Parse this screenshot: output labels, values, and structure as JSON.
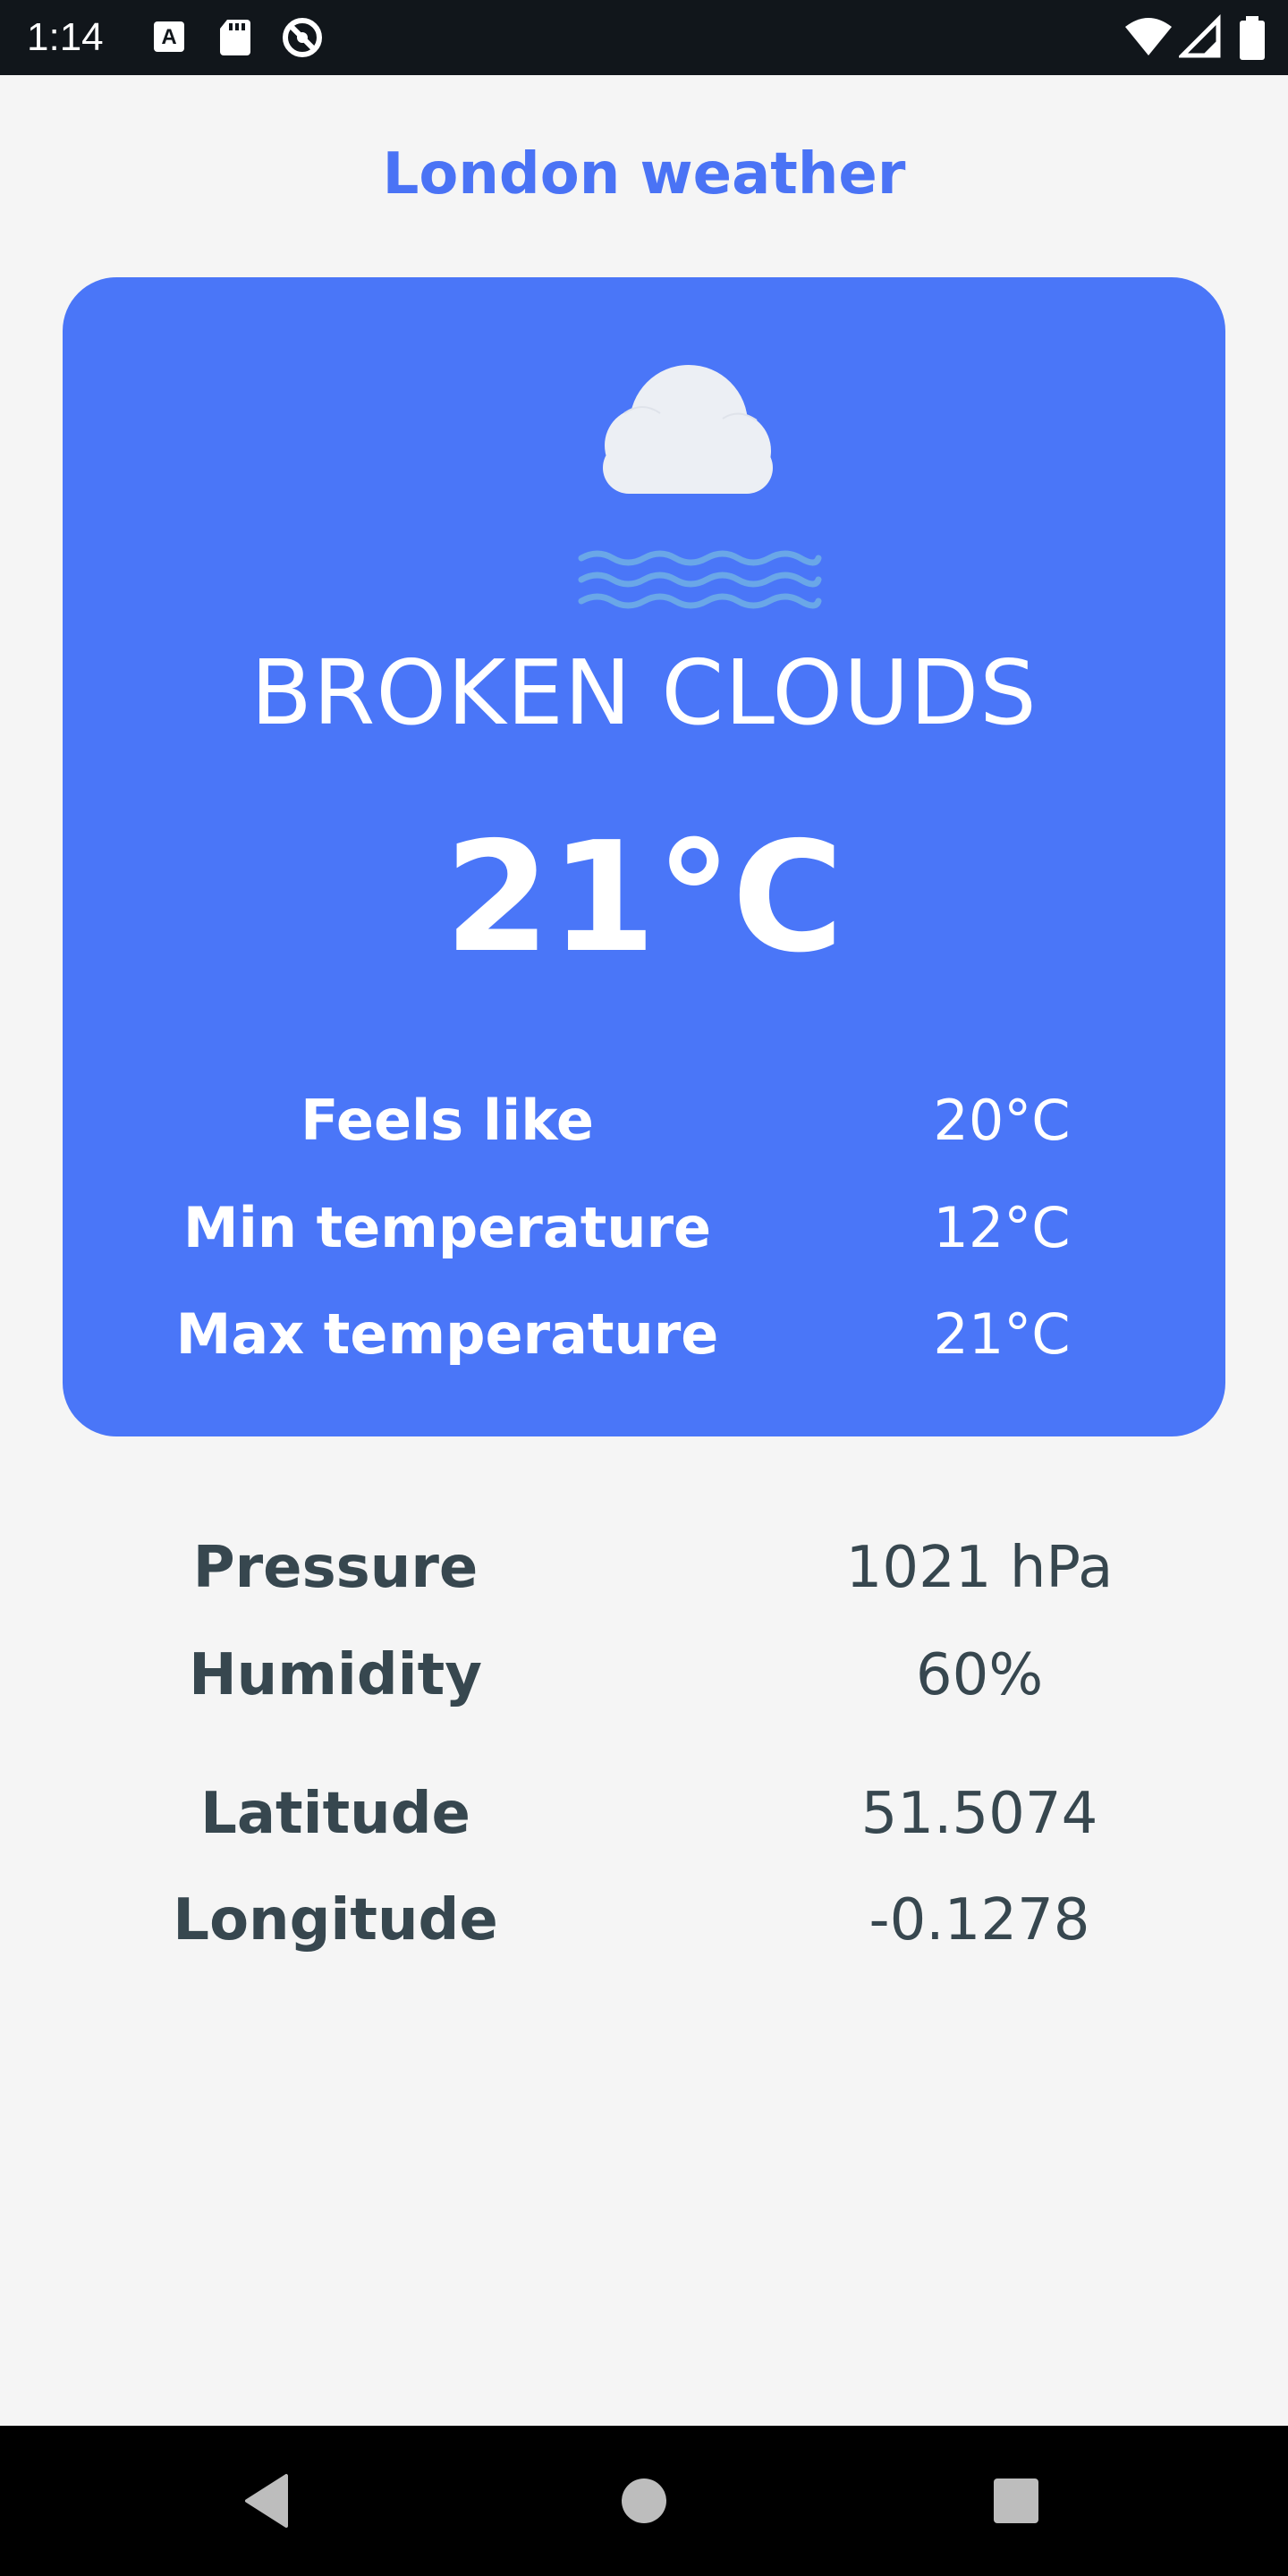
{
  "status_bar": {
    "time": "1:14",
    "icons": [
      "a-notification-icon",
      "sd-card-icon",
      "no-sync-icon",
      "wifi-icon",
      "signal-icon",
      "battery-icon"
    ]
  },
  "page": {
    "title": "London weather"
  },
  "weather": {
    "icon": "cloud-fog-icon",
    "condition": "BROKEN CLOUDS",
    "temperature": "21°C",
    "rows": [
      {
        "label": "Feels like",
        "value": "20°C"
      },
      {
        "label": "Min temperature",
        "value": "12°C"
      },
      {
        "label": "Max temperature",
        "value": "21°C"
      }
    ]
  },
  "details": {
    "pressure_label": "Pressure",
    "pressure_value": "1021 hPa",
    "humidity_label": "Humidity",
    "humidity_value": "60%",
    "latitude_label": "Latitude",
    "latitude_value": "51.5074",
    "longitude_label": "Longitude",
    "longitude_value": "-0.1278"
  },
  "colors": {
    "accent": "#4a73f5",
    "card": "#4a76f8",
    "text_dark": "#37474f",
    "background": "#f5f5f5"
  },
  "nav": {
    "icons": [
      "back-icon",
      "home-icon",
      "recents-icon"
    ]
  }
}
